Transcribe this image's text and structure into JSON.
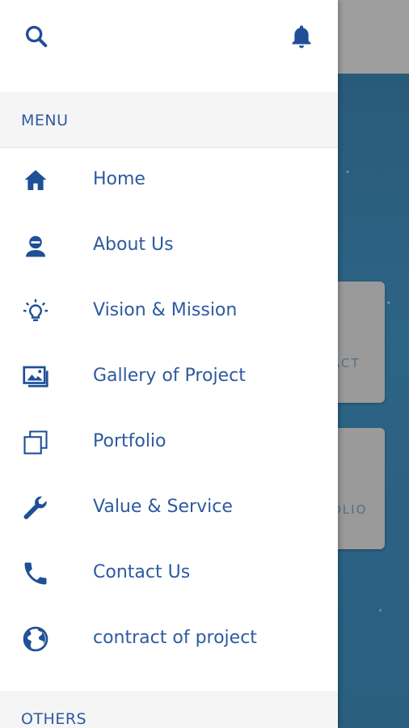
{
  "header": {
    "search_icon": "search-icon",
    "notification_icon": "bell-icon"
  },
  "menu": {
    "section_label": "MENU",
    "items": [
      {
        "label": "Home",
        "icon": "home-icon"
      },
      {
        "label": "About Us",
        "icon": "person-icon"
      },
      {
        "label": "Vision & Mission",
        "icon": "lightbulb-icon"
      },
      {
        "label": "Gallery of Project",
        "icon": "gallery-icon"
      },
      {
        "label": "Portfolio",
        "icon": "stacked-squares-icon"
      },
      {
        "label": "Value & Service",
        "icon": "wrench-icon"
      },
      {
        "label": "Contact Us",
        "icon": "phone-icon"
      },
      {
        "label": "contract of project",
        "icon": "globe-icon"
      }
    ]
  },
  "others": {
    "section_label": "OTHERS"
  },
  "background": {
    "card_1_label": "ACT",
    "card_2_label": "OLIO"
  },
  "colors": {
    "accent": "#2e5aa0",
    "icon": "#1f4f96",
    "drawer_bg": "#ffffff",
    "section_bg": "#f5f5f5"
  }
}
